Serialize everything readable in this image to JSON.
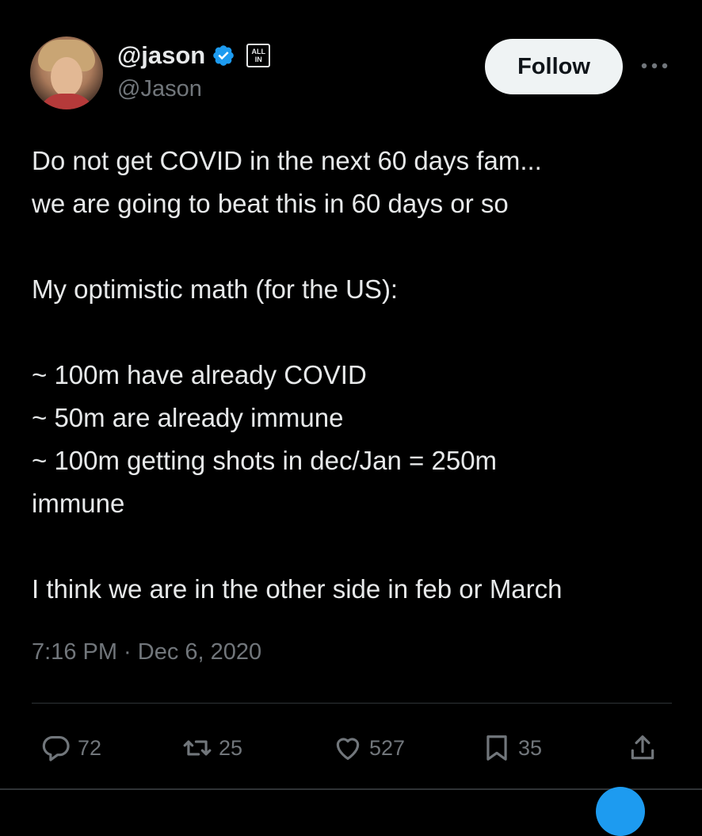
{
  "author": {
    "display_name": "@jason",
    "handle": "@Jason",
    "verified": true,
    "affiliate_badge": "ALL IN"
  },
  "follow_button": {
    "label": "Follow"
  },
  "tweet": {
    "lines": [
      "Do not get COVID in the next 60 days fam...",
      "we are going to beat this in 60 days or so",
      "",
      "My optimistic math (for the US):",
      "",
      "~ 100m have already COVID",
      "~ 50m are already immune",
      "~ 100m getting shots in dec/Jan = 250m",
      "immune",
      "",
      "I think we are in the other side in feb or March"
    ],
    "timestamp": "7:16 PM · Dec 6, 2020"
  },
  "actions": {
    "replies": "72",
    "retweets": "25",
    "likes": "527",
    "bookmarks": "35"
  },
  "colors": {
    "background": "#000000",
    "text": "#e7e9ea",
    "secondary": "#71767b",
    "verified": "#1d9bf0",
    "divider": "#2f3336"
  },
  "icons": [
    "verified-icon",
    "more-icon",
    "reply-icon",
    "retweet-icon",
    "like-icon",
    "bookmark-icon",
    "share-icon"
  ]
}
